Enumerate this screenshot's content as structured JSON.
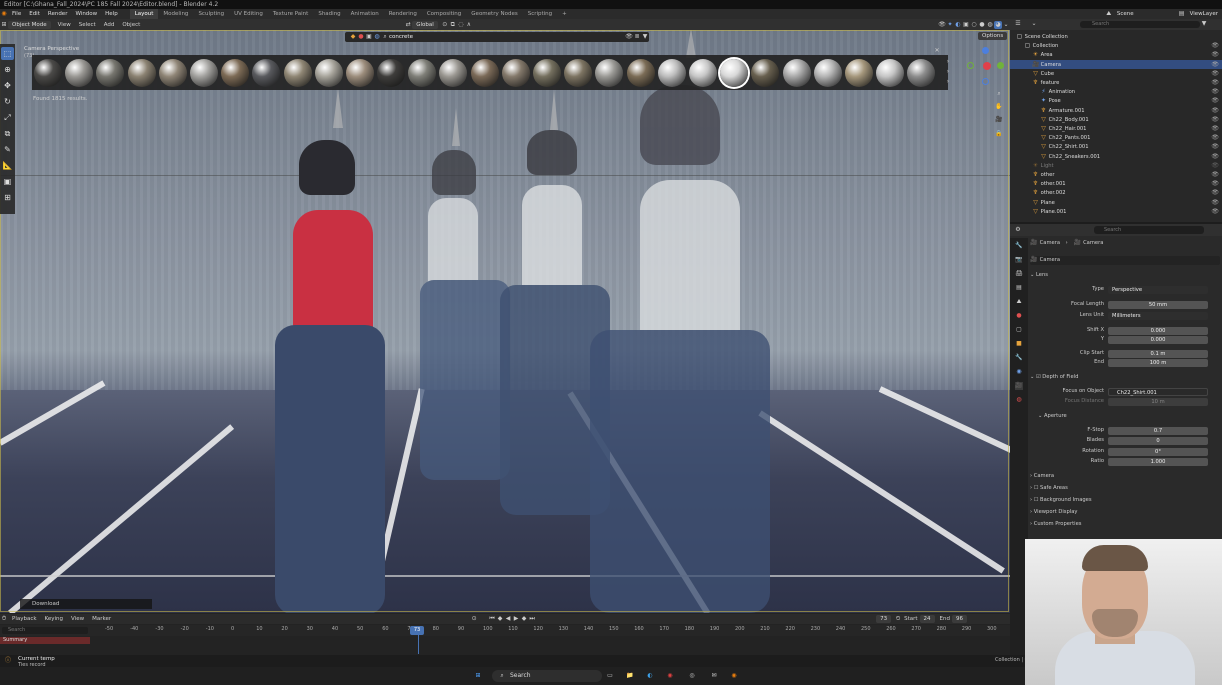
{
  "window_title": "Editor [C:\\Ghana_Fall_2024\\PC 185 Fall 2024\\Editor.blend] - Blender 4.2",
  "menus": [
    "File",
    "Edit",
    "Render",
    "Window",
    "Help"
  ],
  "workspaces": [
    "Layout",
    "Modeling",
    "Sculpting",
    "UV Editing",
    "Texture Paint",
    "Shading",
    "Animation",
    "Rendering",
    "Compositing",
    "Geometry Nodes",
    "Scripting",
    "+"
  ],
  "active_workspace": "Layout",
  "scene_name": "Scene",
  "view_layer": "ViewLayer",
  "viewport_header": {
    "mode": "Object Mode",
    "menus": [
      "View",
      "Select",
      "Add",
      "Object"
    ],
    "orientation": "Global",
    "options_label": "Options"
  },
  "viewport": {
    "camera_label": "Camera Perspective",
    "camera_sublabel": "(73)",
    "material_search": "concrete",
    "found_results": "Found 1815 results.",
    "material_colors": [
      "#4b4a48",
      "#9a9894",
      "#77766f",
      "#8b8272",
      "#8f8576",
      "#a3a29f",
      "#7d6b56",
      "#595a5e",
      "#8f8674",
      "#a7a49b",
      "#9c8d7c",
      "#3e3d3b",
      "#7f7f78",
      "#9a9791",
      "#7b6a58",
      "#84796b",
      "#75705f",
      "#7d7462",
      "#9b9a96",
      "#7b6c56",
      "#bcbcbc",
      "#c7c7c7",
      "#d8d8d8",
      "#68604f",
      "#a9a9a9",
      "#b4b4b4",
      "#a5977c",
      "#c5c5c5",
      "#8d8d8d"
    ]
  },
  "outliner": {
    "search_placeholder": "Search",
    "rows": [
      {
        "label": "Scene Collection",
        "icon": "collection-icon",
        "indent": 0,
        "state": ""
      },
      {
        "label": "Collection",
        "icon": "collection-icon",
        "indent": 1,
        "state": ""
      },
      {
        "label": "Area",
        "icon": "light-icon",
        "indent": 2,
        "state": ""
      },
      {
        "label": "Camera",
        "icon": "camera-icon",
        "indent": 2,
        "state": "selected"
      },
      {
        "label": "Cube",
        "icon": "mesh-icon",
        "indent": 2,
        "state": ""
      },
      {
        "label": "feature",
        "icon": "armature-icon",
        "indent": 2,
        "state": ""
      },
      {
        "label": "Animation",
        "icon": "action-icon",
        "indent": 3,
        "state": ""
      },
      {
        "label": "Pose",
        "icon": "pose-icon",
        "indent": 3,
        "state": ""
      },
      {
        "label": "Armature.001",
        "icon": "armature-icon",
        "indent": 3,
        "state": ""
      },
      {
        "label": "Ch22_Body.001",
        "icon": "mesh-icon",
        "indent": 3,
        "state": ""
      },
      {
        "label": "Ch22_Hair.001",
        "icon": "mesh-icon",
        "indent": 3,
        "state": ""
      },
      {
        "label": "Ch22_Pants.001",
        "icon": "mesh-icon",
        "indent": 3,
        "state": ""
      },
      {
        "label": "Ch22_Shirt.001",
        "icon": "mesh-icon",
        "indent": 3,
        "state": ""
      },
      {
        "label": "Ch22_Sneakers.001",
        "icon": "mesh-icon",
        "indent": 3,
        "state": ""
      },
      {
        "label": "Light",
        "icon": "light-icon",
        "indent": 2,
        "state": "dim"
      },
      {
        "label": "other",
        "icon": "armature-icon",
        "indent": 2,
        "state": ""
      },
      {
        "label": "other.001",
        "icon": "armature-icon",
        "indent": 2,
        "state": ""
      },
      {
        "label": "other.002",
        "icon": "armature-icon",
        "indent": 2,
        "state": ""
      },
      {
        "label": "Plane",
        "icon": "mesh-icon",
        "indent": 2,
        "state": ""
      },
      {
        "label": "Plane.001",
        "icon": "mesh-icon",
        "indent": 2,
        "state": ""
      }
    ]
  },
  "properties": {
    "search_placeholder": "Search",
    "breadcrumb": [
      "Camera",
      "Camera"
    ],
    "data_name": "Camera",
    "sections": {
      "lens": "Lens",
      "dof": "Depth of Field",
      "aperture": "Aperture",
      "camera": "Camera",
      "safe_areas": "Safe Areas",
      "background_images": "Background Images",
      "viewport_display": "Viewport Display",
      "custom_properties": "Custom Properties"
    },
    "fields": [
      {
        "label": "Type",
        "value": "Perspective",
        "kind": "select"
      },
      {
        "label": "Focal Length",
        "value": "50 mm",
        "kind": "num"
      },
      {
        "label": "Lens Unit",
        "value": "Millimeters",
        "kind": "select"
      },
      {
        "label": "Shift X",
        "value": "0.000",
        "kind": "num"
      },
      {
        "label": "Y",
        "value": "0.000",
        "kind": "num"
      },
      {
        "label": "Clip Start",
        "value": "0.1 m",
        "kind": "num"
      },
      {
        "label": "End",
        "value": "100 m",
        "kind": "num"
      }
    ],
    "focus_on_object_label": "Focus on Object",
    "focus_on_object_value": "Ch22_Shirt.001",
    "focus_distance_label": "Focus Distance",
    "focus_distance_value": "10 m",
    "aperture_fields": [
      {
        "label": "F-Stop",
        "value": "0.7"
      },
      {
        "label": "Blades",
        "value": "0"
      },
      {
        "label": "Rotation",
        "value": "0°"
      },
      {
        "label": "Ratio",
        "value": "1.000"
      }
    ]
  },
  "timeline": {
    "menus": [
      "Playback",
      "Keying",
      "View",
      "Marker"
    ],
    "current_frame": "73",
    "start_label": "Start",
    "start": "24",
    "end_label": "End",
    "end": "96",
    "ticks": [
      "-50",
      "-40",
      "-30",
      "-20",
      "-10",
      "0",
      "10",
      "20",
      "30",
      "40",
      "50",
      "60",
      "70",
      "80",
      "90",
      "100",
      "110",
      "120",
      "130",
      "140",
      "150",
      "160",
      "170",
      "180",
      "190",
      "200",
      "210",
      "220",
      "230",
      "240",
      "250",
      "260",
      "270",
      "280",
      "290",
      "300"
    ],
    "search_placeholder": "Search",
    "summary_label": "Summary"
  },
  "download_label": "Download",
  "status": {
    "message": "Current temp",
    "sub": "Ties record",
    "right": "Collection | Camera",
    "version": "4.2.0"
  },
  "taskbar": {
    "search_label": "Search"
  }
}
